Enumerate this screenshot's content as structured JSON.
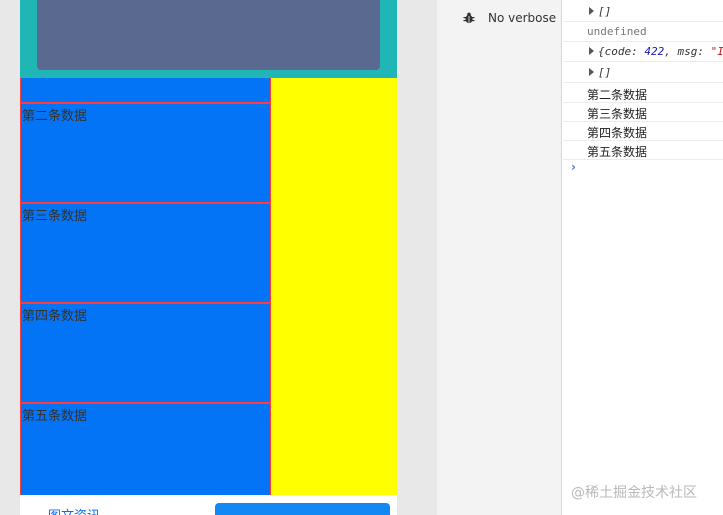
{
  "phone": {
    "list_items": [
      "第二条数据",
      "第三条数据",
      "第四条数据",
      "第五条数据"
    ],
    "bottom_link": "图文资讯"
  },
  "devtools": {
    "verbose_label": "No verbose",
    "console": {
      "line1": "[]",
      "line2": "undefined",
      "line3_a": "{code: ",
      "line3_num": "422",
      "line3_b": ", msg: ",
      "line3_str": "\"I",
      "line4": "[]",
      "logs": [
        "第二条数据",
        "第三条数据",
        "第四条数据",
        "第五条数据"
      ],
      "prompt": "›"
    }
  },
  "watermark": "@稀土掘金技术社区",
  "colors": {
    "banner": "#20b6b6",
    "banner_card": "#59698f",
    "list_bg": "#0474f6",
    "row_border": "#ff3b3b",
    "side_bg": "#ffff00",
    "accent": "#1288f4"
  }
}
